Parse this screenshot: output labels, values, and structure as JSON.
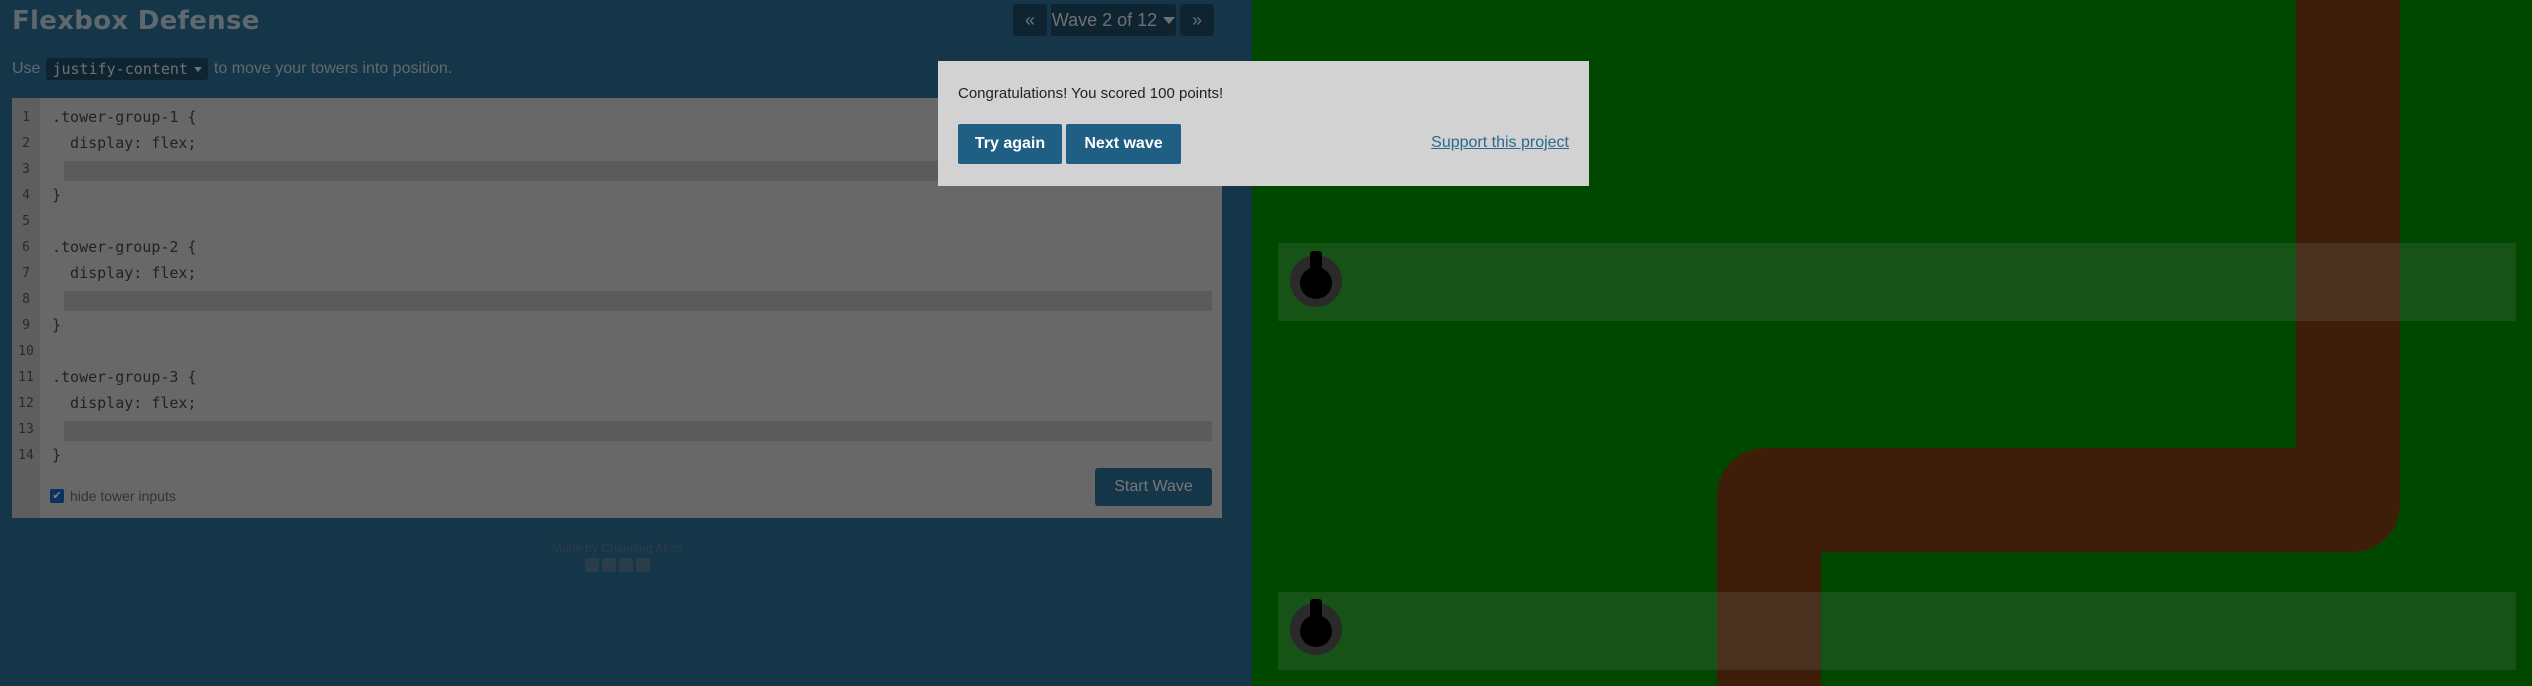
{
  "header": {
    "title": "Flexbox Defense",
    "wave_label": "Wave 2 of 12",
    "prev_icon": "«",
    "next_icon": "»"
  },
  "instructions": {
    "prefix": "Use",
    "property": "justify-content",
    "suffix": "to move your towers into position."
  },
  "editor": {
    "line_numbers": [
      "1",
      "2",
      "3",
      "4",
      "5",
      "6",
      "7",
      "8",
      "9",
      "10",
      "11",
      "12",
      "13",
      "14"
    ],
    "code": {
      "group1_selector": ".tower-group-1 {",
      "group1_display": "  display: flex;",
      "group1_close": "}",
      "group2_selector": ".tower-group-2 {",
      "group2_display": "  display: flex;",
      "group2_close": "}",
      "group3_selector": ".tower-group-3 {",
      "group3_display": "  display: flex;",
      "group3_close": "}"
    },
    "hide_inputs_label": "hide tower inputs",
    "hide_inputs_checked": true,
    "start_wave_label": "Start Wave"
  },
  "footer": {
    "credit": "Made by Channing Allen",
    "social_icons": [
      "facebook-icon",
      "twitter-icon",
      "linkedin-icon",
      "github-icon"
    ]
  },
  "modal": {
    "message": "Congratulations! You scored 100 points!",
    "try_again_label": "Try again",
    "next_wave_label": "Next wave",
    "support_label": "Support this project"
  },
  "colors": {
    "left_panel": "#2a6a91",
    "grass": "#009000",
    "path": "#7e3d12",
    "button": "#1f5f84"
  }
}
